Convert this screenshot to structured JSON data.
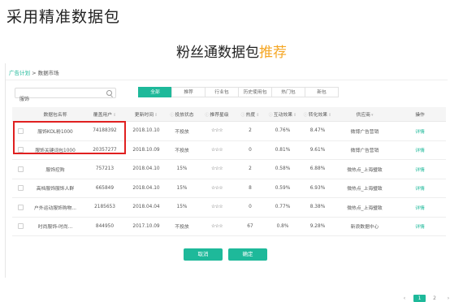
{
  "heading": "采用精准数据包",
  "subtitle": {
    "main": "粉丝通数据包",
    "highlight": "推荐"
  },
  "breadcrumb": {
    "link": "广告计划",
    "separator": ">",
    "current": "数据市场"
  },
  "search": {
    "value": "服饰"
  },
  "tabs": [
    {
      "label": "全部",
      "active": true
    },
    {
      "label": "推荐",
      "active": false
    },
    {
      "label": "行业包",
      "active": false
    },
    {
      "label": "历史使用包",
      "active": false
    },
    {
      "label": "热门包",
      "active": false
    },
    {
      "label": "新包",
      "active": false
    }
  ],
  "table": {
    "headers": [
      "数据包名称",
      "覆盖用户",
      "更新时间",
      "投放状态",
      "推荐星级",
      "热度",
      "互动效果",
      "转化效果",
      "供应商",
      "操作"
    ],
    "rows": [
      [
        "服饰KOL粉1000",
        "74188392",
        "2018.10.10",
        "不投放",
        "☆☆☆",
        "2",
        "0.76%",
        "8.47%",
        "微博广告营销",
        "详情"
      ],
      [
        "服饰关键词包1000",
        "20357277",
        "2018.10.09",
        "不投放",
        "☆☆☆",
        "0",
        "0.81%",
        "9.61%",
        "微博广告营销",
        "详情"
      ],
      [
        "服饰控购",
        "757213",
        "2018.04.10",
        "15%",
        "☆☆☆",
        "2",
        "0.58%",
        "6.88%",
        "微热点_上海璧致",
        "详情"
      ],
      [
        "高档服饰服饰人群",
        "665849",
        "2018.04.10",
        "15%",
        "☆☆☆",
        "8",
        "0.59%",
        "6.93%",
        "微热点_上海璧致",
        "详情"
      ],
      [
        "户外运动服饰购物...",
        "2185653",
        "2018.04.04",
        "15%",
        "☆☆☆",
        "0",
        "0.77%",
        "8.38%",
        "微热点_上海璧致",
        "详情"
      ],
      [
        "时尚服饰-时尚...",
        "844950",
        "2017.10.09",
        "不投放",
        "☆☆☆",
        "67",
        "0.8%",
        "9.28%",
        "新浪数据中心",
        "详情"
      ]
    ]
  },
  "pagination": {
    "prev": "‹",
    "pages": [
      "1",
      "2"
    ],
    "current": "1",
    "next": "›"
  },
  "buttons": {
    "cancel": "取消",
    "confirm": "确定"
  },
  "colors": {
    "accent": "#1eb99a",
    "highlight": "#f5a623",
    "annotation": "#e02020"
  }
}
